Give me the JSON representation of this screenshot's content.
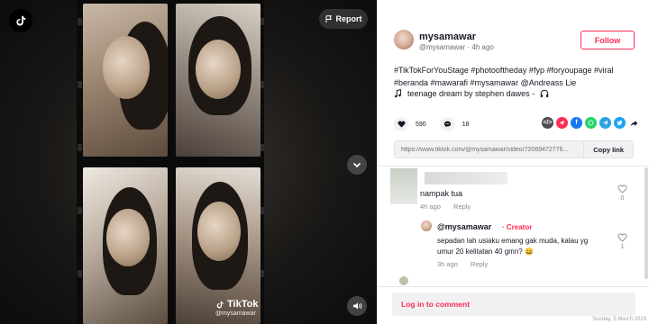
{
  "video": {
    "report_label": "Report",
    "watermark_brand": "TikTok",
    "watermark_handle": "@mysamawar"
  },
  "post": {
    "username": "mysamawar",
    "handle": "@mysamawar",
    "time_ago": "4h ago",
    "follow_label": "Follow",
    "caption_line1": "#TikTokForYouStage #photooftheday #fyp #foryoupage #viral",
    "caption_line2": "#beranda #mawarafi #mysamawar @Andreass Lie",
    "music": "teenage dream by stephen dawes -",
    "likes": "590",
    "comments_count": "18",
    "link_url": "https://www.tiktok.com/@mysamawar/video/72069472776...",
    "copy_link_label": "Copy link"
  },
  "comments": [
    {
      "text": "nampak tua",
      "time": "4h ago",
      "reply_label": "Reply",
      "likes": "0"
    },
    {
      "username": "@mysamawar",
      "badge": "· Creator",
      "text": "sepadan lah usiaku emang gak muda, kalau yg umur 20 kelitatan 40 gmn? 😄",
      "time": "3h ago",
      "reply_label": "Reply",
      "likes": "1"
    }
  ],
  "login_label": "Log in to comment",
  "screenshot_stamp": "Sunday, 5 March 2023",
  "colors": {
    "accent": "#fe2c55",
    "text": "#161823",
    "muted": "#6b6d75"
  },
  "icons": {
    "share_embed": "embed-icon",
    "share_send": "send-icon",
    "share_facebook": "facebook-icon",
    "share_whatsapp": "whatsapp-icon",
    "share_telegram": "telegram-icon",
    "share_twitter": "twitter-icon",
    "share_more": "share-arrow-icon"
  }
}
